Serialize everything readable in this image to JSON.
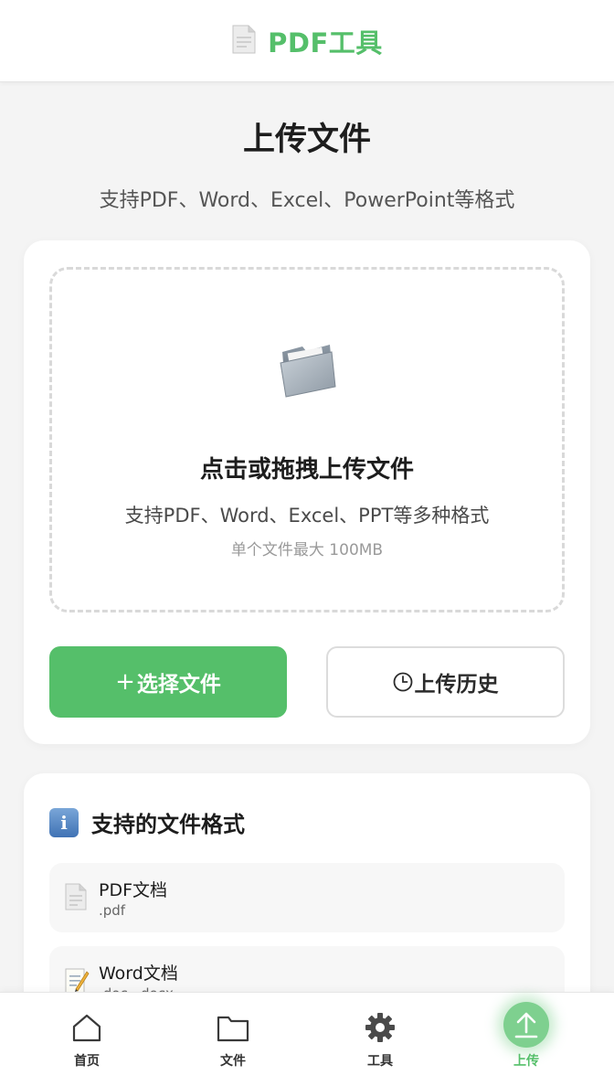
{
  "header": {
    "title": "PDF工具",
    "icon": "document-icon"
  },
  "page": {
    "title": "上传文件",
    "subtitle": "支持PDF、Word、Excel、PowerPoint等格式"
  },
  "dropzone": {
    "icon": "folder-icon",
    "title": "点击或拖拽上传文件",
    "subtitle": "支持PDF、Word、Excel、PPT等多种格式",
    "limit": "单个文件最大 100MB"
  },
  "actions": {
    "select_glyph": "+",
    "select_label": "选择文件",
    "history_label": "上传历史"
  },
  "formats": {
    "title": "支持的文件格式",
    "items": [
      {
        "name": "PDF文档",
        "ext": ".pdf",
        "icon": "pdf-document-icon"
      },
      {
        "name": "Word文档",
        "ext": ".doc, .docx",
        "icon": "word-document-icon"
      }
    ]
  },
  "tabbar": {
    "items": [
      {
        "label": "首页",
        "icon": "home-icon"
      },
      {
        "label": "文件",
        "icon": "folder-icon"
      },
      {
        "label": "工具",
        "icon": "gear-icon"
      },
      {
        "label": "上传",
        "icon": "upload-icon",
        "active": true
      }
    ]
  },
  "colors": {
    "accent": "#55bf6a",
    "background": "#f4f4f4"
  }
}
